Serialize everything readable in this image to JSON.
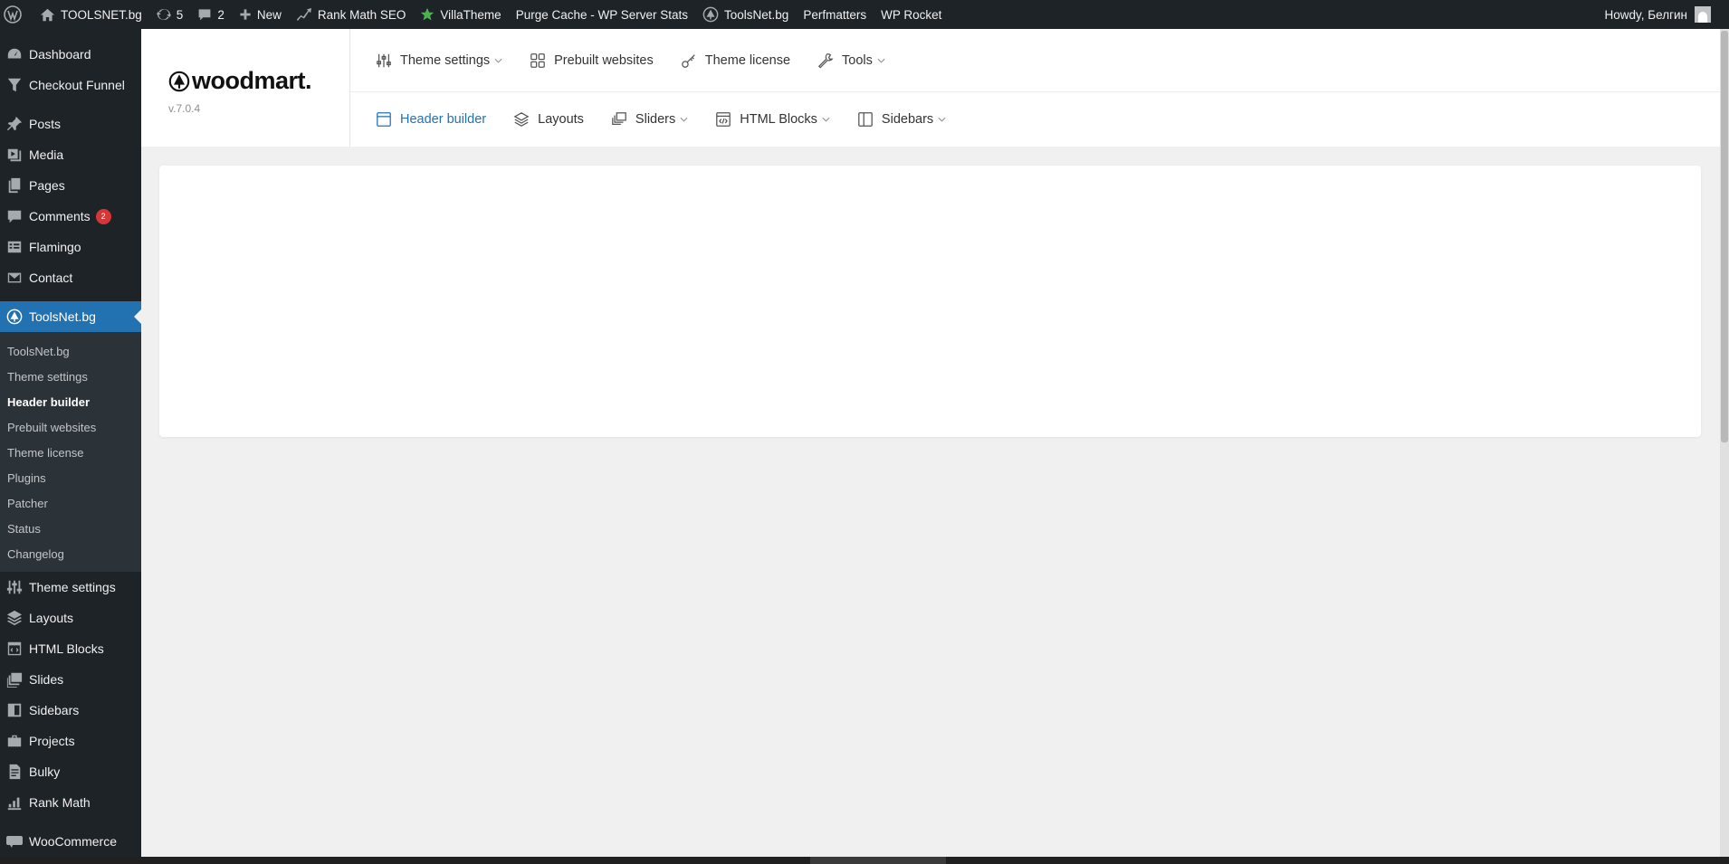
{
  "adminbar": {
    "site_name": "TOOLSNET.bg",
    "updates_count": "5",
    "comments_count": "2",
    "new_label": "New",
    "rank_math": "Rank Math SEO",
    "villatheme": "VillaTheme",
    "purge_cache": "Purge Cache - WP Server Stats",
    "toolsnet": "ToolsNet.bg",
    "perfmatters": "Perfmatters",
    "wp_rocket": "WP Rocket",
    "howdy": "Howdy, Белгин"
  },
  "sidebar": {
    "dashboard": "Dashboard",
    "checkout_funnel": "Checkout Funnel",
    "posts": "Posts",
    "media": "Media",
    "pages": "Pages",
    "comments": "Comments",
    "comments_badge": "2",
    "flamingo": "Flamingo",
    "contact": "Contact",
    "toolsnet": "ToolsNet.bg",
    "submenu": {
      "toolsnet": "ToolsNet.bg",
      "theme_settings": "Theme settings",
      "header_builder": "Header builder",
      "prebuilt_websites": "Prebuilt websites",
      "theme_license": "Theme license",
      "plugins": "Plugins",
      "patcher": "Patcher",
      "status": "Status",
      "changelog": "Changelog"
    },
    "theme_settings": "Theme settings",
    "layouts": "Layouts",
    "html_blocks": "HTML Blocks",
    "slides": "Slides",
    "sidebars": "Sidebars",
    "projects": "Projects",
    "bulky": "Bulky",
    "rank_math": "Rank Math",
    "woocommerce": "WooCommerce"
  },
  "woodmart": {
    "logo_text": "woodmart.",
    "version": "v.7.0.4",
    "nav_row1": {
      "theme_settings": "Theme settings",
      "prebuilt_websites": "Prebuilt websites",
      "theme_license": "Theme license",
      "tools": "Tools"
    },
    "nav_row2": {
      "header_builder": "Header builder",
      "layouts": "Layouts",
      "sliders": "Sliders",
      "html_blocks": "HTML Blocks",
      "sidebars": "Sidebars"
    }
  },
  "colors": {
    "admin_bar": "#1d2327",
    "accent": "#2271b1",
    "badge": "#d63638",
    "background": "#f0f0f1"
  }
}
